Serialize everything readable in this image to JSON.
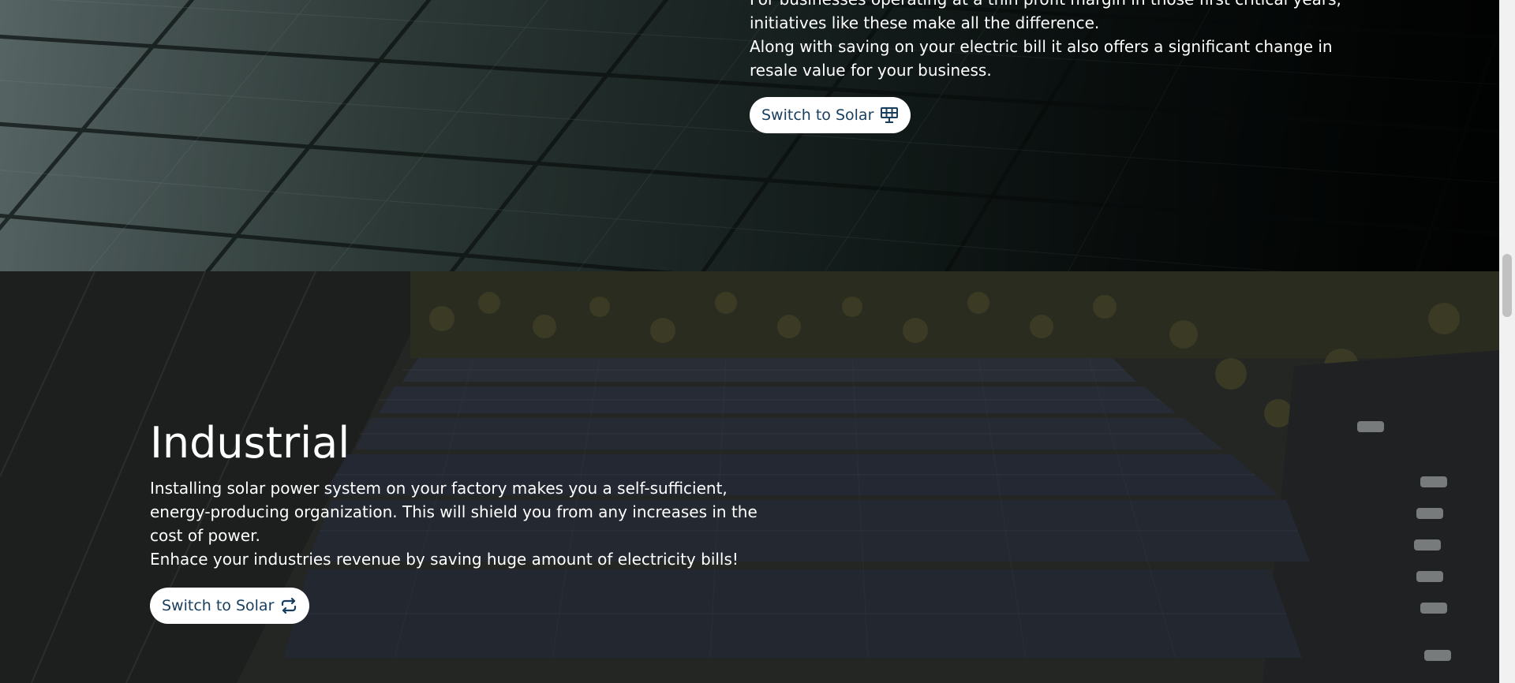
{
  "commercial": {
    "paragraph_partial": "For businesses operating at a thin profit margin in those first critical years, initiatives like these make all the difference.",
    "paragraph_2": "Along with saving on your electric bill it also offers a significant change in resale value for your business.",
    "button": {
      "label": "Switch to Solar",
      "icon": "solar-panel-icon"
    }
  },
  "industrial": {
    "title": "Industrial",
    "paragraph_1": "Installing solar power system on your factory makes you a self-sufficient, energy-producing organization. This will shield you from any increases in the cost of power.",
    "paragraph_2": "Enhace your industries revenue by saving huge amount of electricity bills!",
    "button": {
      "label": "Switch to Solar",
      "icon": "arrows-repeat-icon"
    }
  },
  "colors": {
    "button_text": "#173e5e",
    "button_bg": "#ffffff",
    "body_text": "#ffffff"
  }
}
